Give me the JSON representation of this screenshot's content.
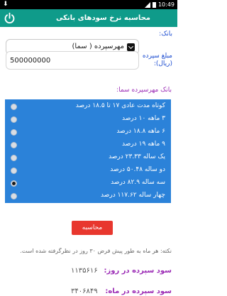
{
  "statusbar": {
    "time": "10:49"
  },
  "appbar": {
    "title": "محاسبه نرخ سودهای بانکی",
    "power_icon": "power-icon"
  },
  "form": {
    "bank_label": "بانک:",
    "bank_selected": "مهرسپرده ( سما)",
    "amount_label": "مبلغ سپرده (ریال):",
    "amount_value": "500000000"
  },
  "plan_section_title": "بانک مهرسپرده سما:",
  "plans": [
    {
      "label": "کوتاه مدت عادی ۱۷ تا ۱۸.۵ درصد",
      "selected": false
    },
    {
      "label": "۳ ماهه ۱۰ درصد",
      "selected": false
    },
    {
      "label": "۶ ماهه ۱۸.۸ درصد",
      "selected": false
    },
    {
      "label": "۹ ماهه ۱۹ درصد",
      "selected": false
    },
    {
      "label": "یک ساله ۲۳.۳۳ درصد",
      "selected": false
    },
    {
      "label": "دو ساله ۵۰.۴۸ درصد",
      "selected": false
    },
    {
      "label": "سه ساله ۸۲.۹ درصد",
      "selected": true
    },
    {
      "label": "چهار ساله ۱۱۷.۶۲ درصد",
      "selected": false
    }
  ],
  "calculate_label": "محاسبه",
  "note": "نکته: هر ماه به طور پیش فرض ۳۰ روز در نظرگرفته شده است.",
  "results": {
    "daily_label": "سود سپرده در روز:",
    "daily_value": "۱۱۳۵۶۱۶",
    "monthly_label": "سود سپرده در ماه:",
    "monthly_value": "۳۴۰۶۸۴۹"
  }
}
